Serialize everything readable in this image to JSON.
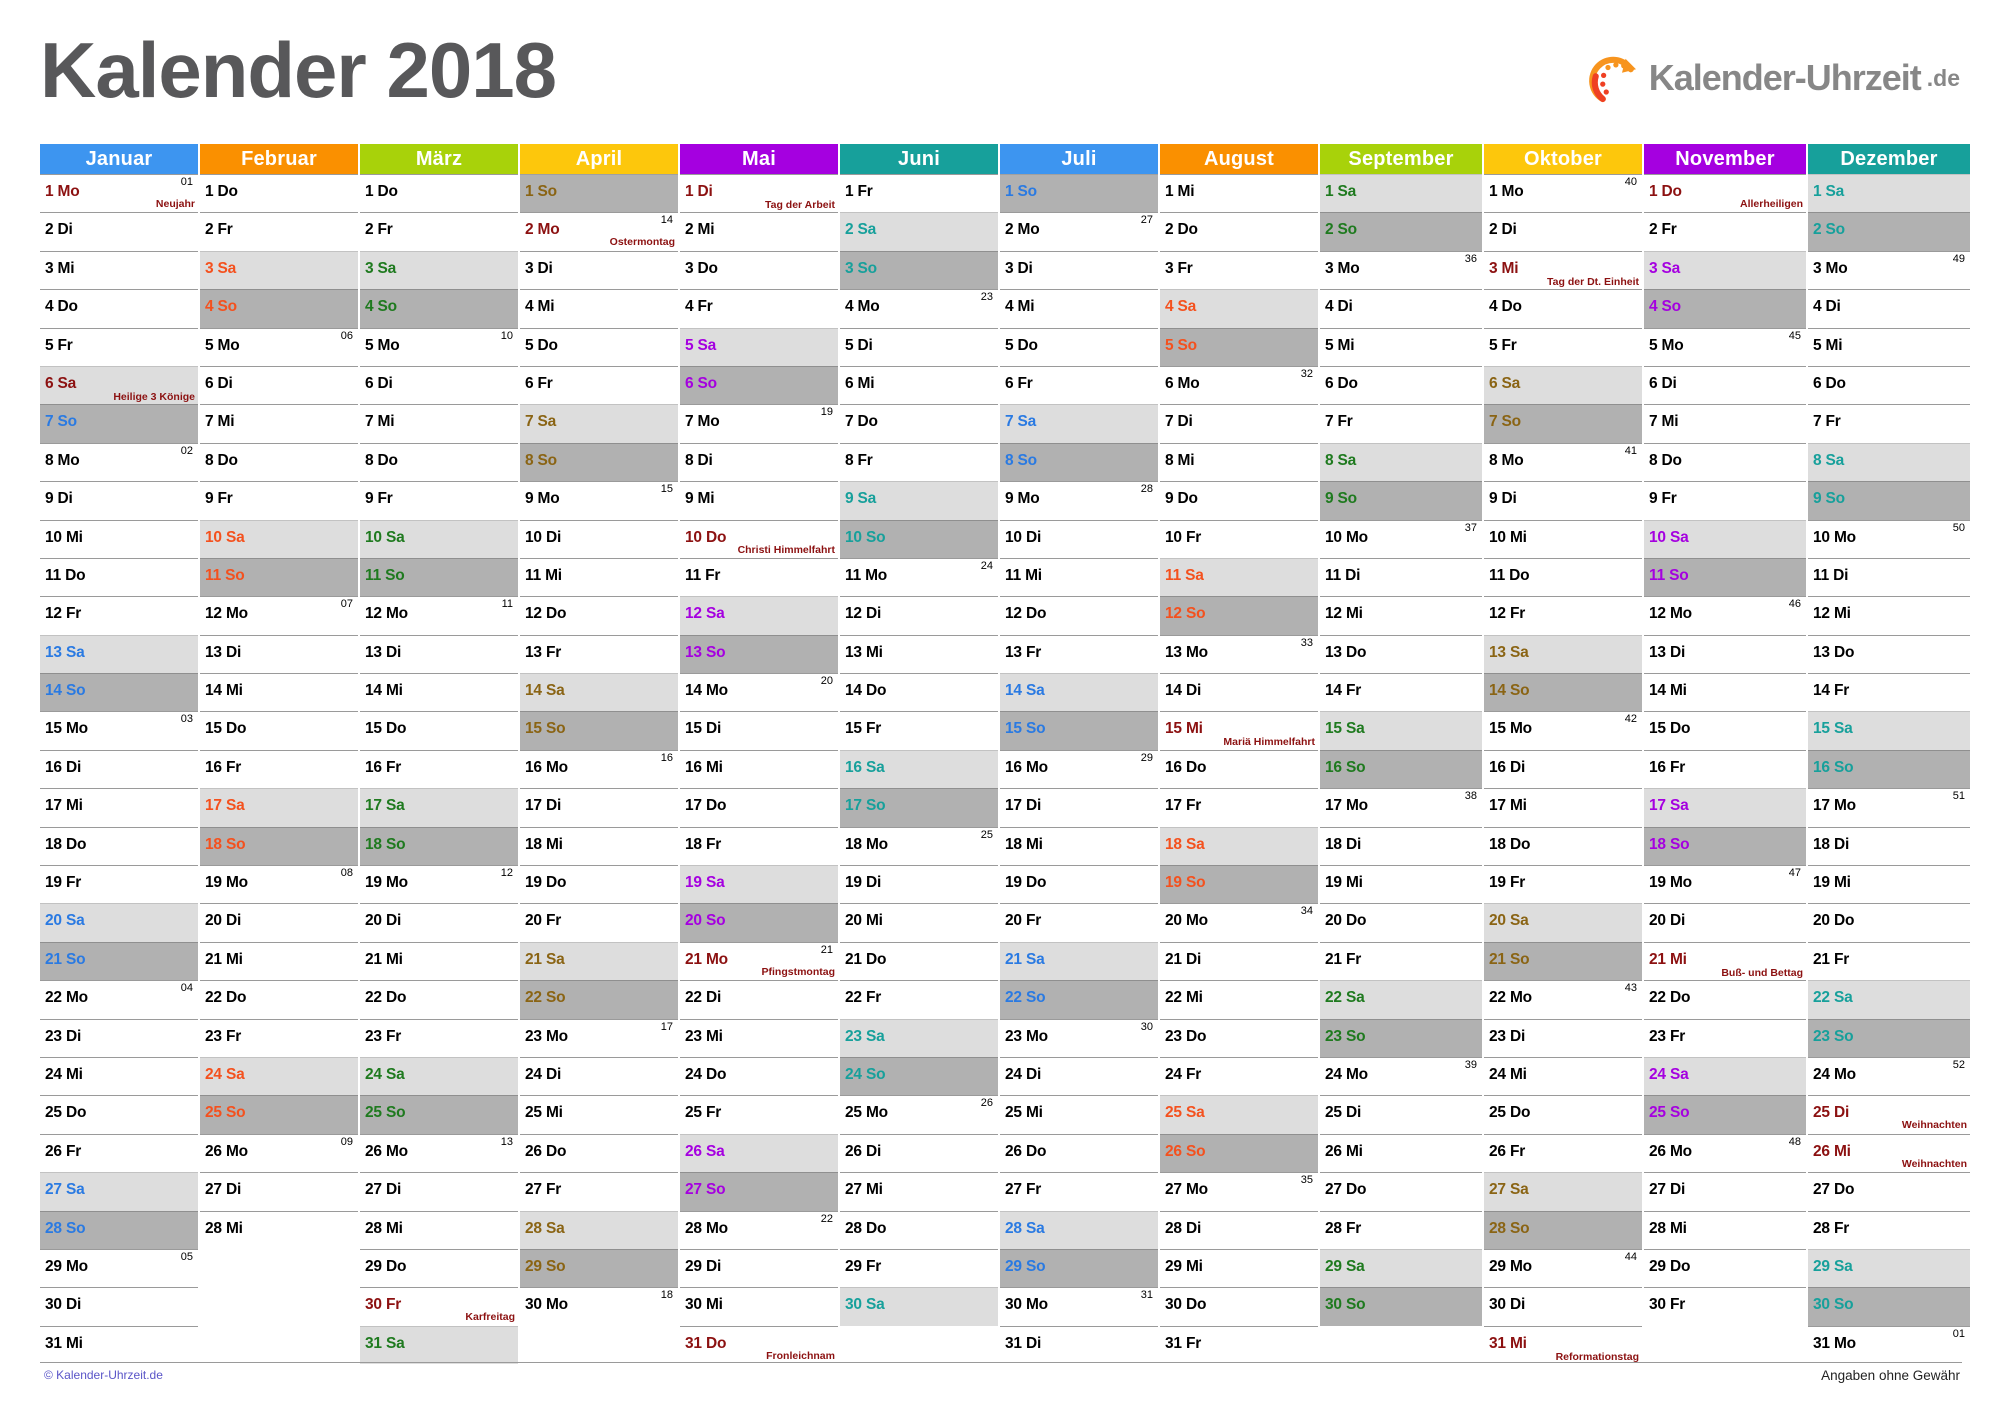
{
  "header": {
    "title": "Kalender 2018",
    "logo": {
      "icon": "clock-dots-icon",
      "name": "Kalender-Uhrzeit",
      "tld": ".de"
    }
  },
  "footer": {
    "copyright": "© Kalender-Uhrzeit.de",
    "disclaimer": "Angaben ohne Gewähr"
  },
  "colors": {
    "blue": "#3d95f0",
    "orange": "#fa9000",
    "green": "#a8d20a",
    "yellow": "#fdc70c",
    "purple": "#a500e0",
    "teal": "#17a09b",
    "saturday_bg": "#dddddd",
    "sunday_bg": "#b1b1b1",
    "holiday_text": "#8c1111",
    "title_grey": "#58585a"
  },
  "weekday_labels": [
    "Mo",
    "Di",
    "Mi",
    "Do",
    "Fr",
    "Sa",
    "So"
  ],
  "months": [
    {
      "name": "Januar",
      "color": "#3d95f0",
      "weekend_text": "#2a7ae2",
      "first_weekday": 0,
      "length": 31,
      "week_numbers": {
        "1": "01",
        "8": "02",
        "15": "03",
        "22": "04",
        "29": "05"
      },
      "holidays": {
        "1": "Neujahr",
        "6": "Heilige 3 Könige"
      }
    },
    {
      "name": "Februar",
      "color": "#fa9000",
      "weekend_text": "#f4511e",
      "first_weekday": 3,
      "length": 28,
      "week_numbers": {
        "5": "06",
        "12": "07",
        "19": "08",
        "26": "09"
      },
      "holidays": {}
    },
    {
      "name": "März",
      "color": "#a8d20a",
      "weekend_text": "#1f7a1f",
      "first_weekday": 3,
      "length": 31,
      "week_numbers": {
        "5": "10",
        "12": "11",
        "19": "12",
        "26": "13"
      },
      "holidays": {
        "30": "Karfreitag"
      }
    },
    {
      "name": "April",
      "color": "#fdc70c",
      "weekend_text": "#8a6414",
      "first_weekday": 6,
      "length": 30,
      "week_numbers": {
        "2": "14",
        "9": "15",
        "16": "16",
        "23": "17",
        "30": "18"
      },
      "holidays": {
        "2": "Ostermontag"
      }
    },
    {
      "name": "Mai",
      "color": "#a500e0",
      "weekend_text": "#a500e0",
      "first_weekday": 1,
      "length": 31,
      "week_numbers": {
        "7": "19",
        "14": "20",
        "21": "21",
        "28": "22"
      },
      "holidays": {
        "1": "Tag der Arbeit",
        "10": "Christi Himmelfahrt",
        "21": "Pfingstmontag",
        "31": "Fronleichnam"
      }
    },
    {
      "name": "Juni",
      "color": "#17a09b",
      "weekend_text": "#17a09b",
      "first_weekday": 4,
      "length": 30,
      "week_numbers": {
        "4": "23",
        "11": "24",
        "18": "25",
        "25": "26"
      },
      "holidays": {}
    },
    {
      "name": "Juli",
      "color": "#3d95f0",
      "weekend_text": "#2a7ae2",
      "first_weekday": 6,
      "length": 31,
      "week_numbers": {
        "2": "27",
        "9": "28",
        "16": "29",
        "23": "30",
        "30": "31"
      },
      "holidays": {}
    },
    {
      "name": "August",
      "color": "#fa9000",
      "weekend_text": "#f4511e",
      "first_weekday": 2,
      "length": 31,
      "week_numbers": {
        "6": "32",
        "13": "33",
        "20": "34",
        "27": "35"
      },
      "holidays": {
        "15": "Mariä Himmelfahrt"
      }
    },
    {
      "name": "September",
      "color": "#a8d20a",
      "weekend_text": "#1f7a1f",
      "first_weekday": 5,
      "length": 30,
      "week_numbers": {
        "3": "36",
        "10": "37",
        "17": "38",
        "24": "39"
      },
      "holidays": {}
    },
    {
      "name": "Oktober",
      "color": "#fdc70c",
      "weekend_text": "#8a6414",
      "first_weekday": 0,
      "length": 31,
      "week_numbers": {
        "1": "40",
        "8": "41",
        "15": "42",
        "22": "43",
        "29": "44"
      },
      "holidays": {
        "3": "Tag der Dt. Einheit",
        "31": "Reformationstag"
      }
    },
    {
      "name": "November",
      "color": "#a500e0",
      "weekend_text": "#a500e0",
      "first_weekday": 3,
      "length": 30,
      "week_numbers": {
        "5": "45",
        "12": "46",
        "19": "47",
        "26": "48"
      },
      "holidays": {
        "1": "Allerheiligen",
        "21": "Buß- und Bettag"
      }
    },
    {
      "name": "Dezember",
      "color": "#17a09b",
      "weekend_text": "#17a09b",
      "first_weekday": 5,
      "length": 31,
      "week_numbers": {
        "3": "49",
        "10": "50",
        "17": "51",
        "24": "52",
        "31": "01"
      },
      "holidays": {
        "25": "Weihnachten",
        "26": "Weihnachten"
      }
    }
  ]
}
